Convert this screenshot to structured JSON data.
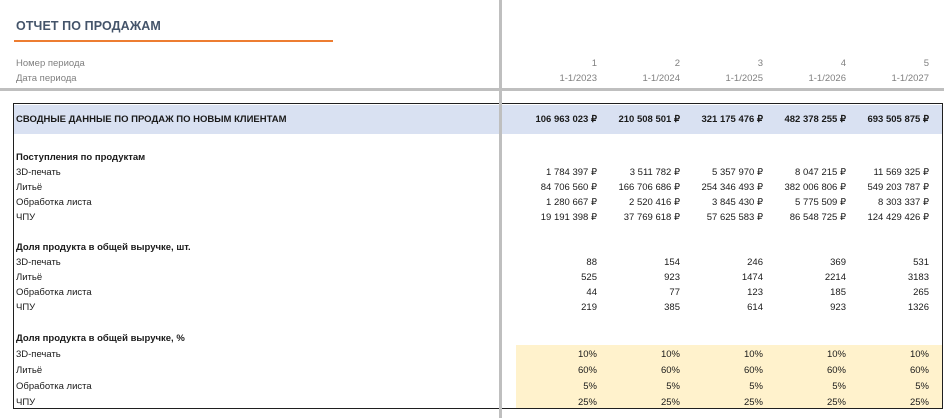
{
  "report": {
    "title": "ОТЧЕТ ПО ПРОДАЖАМ"
  },
  "colors": {
    "title_text": "#44546a",
    "title_underline": "#ed7d31",
    "summary_band": "#d9e1f2",
    "share_highlight": "#fff2cc",
    "grid_separator": "#bfbfbf"
  },
  "header": {
    "period_number_label": "Номер периода",
    "period_date_label": "Дата периода",
    "period_numbers": [
      "1",
      "2",
      "3",
      "4",
      "5"
    ],
    "period_dates": [
      "1-1/2023",
      "1-1/2024",
      "1-1/2025",
      "1-1/2026",
      "1-1/2027"
    ]
  },
  "summary": {
    "label": "СВОДНЫЕ ДАННЫЕ ПО ПРОДАЖ ПО НОВЫМ КЛИЕНТАМ",
    "values": [
      "106 963 023 ₽",
      "210 508 501 ₽",
      "321 175 476 ₽",
      "482 378 255 ₽",
      "693 505 875 ₽"
    ]
  },
  "revenue": {
    "heading": "Поступления по продуктам",
    "rows": [
      {
        "label": "3D-печать",
        "values": [
          "1 784 397 ₽",
          "3 511 782 ₽",
          "5 357 970 ₽",
          "8 047 215 ₽",
          "11 569 325 ₽"
        ]
      },
      {
        "label": "Литьё",
        "values": [
          "84 706 560 ₽",
          "166 706 686 ₽",
          "254 346 493 ₽",
          "382 006 806 ₽",
          "549 203 787 ₽"
        ]
      },
      {
        "label": "Обработка листа",
        "values": [
          "1 280 667 ₽",
          "2 520 416 ₽",
          "3 845 430 ₽",
          "5 775 509 ₽",
          "8 303 337 ₽"
        ]
      },
      {
        "label": "ЧПУ",
        "values": [
          "19 191 398 ₽",
          "37 769 618 ₽",
          "57 625 583 ₽",
          "86 548 725 ₽",
          "124 429 426 ₽"
        ]
      }
    ]
  },
  "units": {
    "heading": "Доля продукта в общей выручке, шт.",
    "rows": [
      {
        "label": "3D-печать",
        "values": [
          "88",
          "154",
          "246",
          "369",
          "531"
        ]
      },
      {
        "label": "Литьё",
        "values": [
          "525",
          "923",
          "1474",
          "2214",
          "3183"
        ]
      },
      {
        "label": "Обработка листа",
        "values": [
          "44",
          "77",
          "123",
          "185",
          "265"
        ]
      },
      {
        "label": "ЧПУ",
        "values": [
          "219",
          "385",
          "614",
          "923",
          "1326"
        ]
      }
    ]
  },
  "shares": {
    "heading": "Доля продукта в общей выручке, %",
    "rows": [
      {
        "label": "3D-печать",
        "values": [
          "10%",
          "10%",
          "10%",
          "10%",
          "10%"
        ]
      },
      {
        "label": "Литьё",
        "values": [
          "60%",
          "60%",
          "60%",
          "60%",
          "60%"
        ]
      },
      {
        "label": "Обработка листа",
        "values": [
          "5%",
          "5%",
          "5%",
          "5%",
          "5%"
        ]
      },
      {
        "label": "ЧПУ",
        "values": [
          "25%",
          "25%",
          "25%",
          "25%",
          "25%"
        ]
      }
    ]
  }
}
